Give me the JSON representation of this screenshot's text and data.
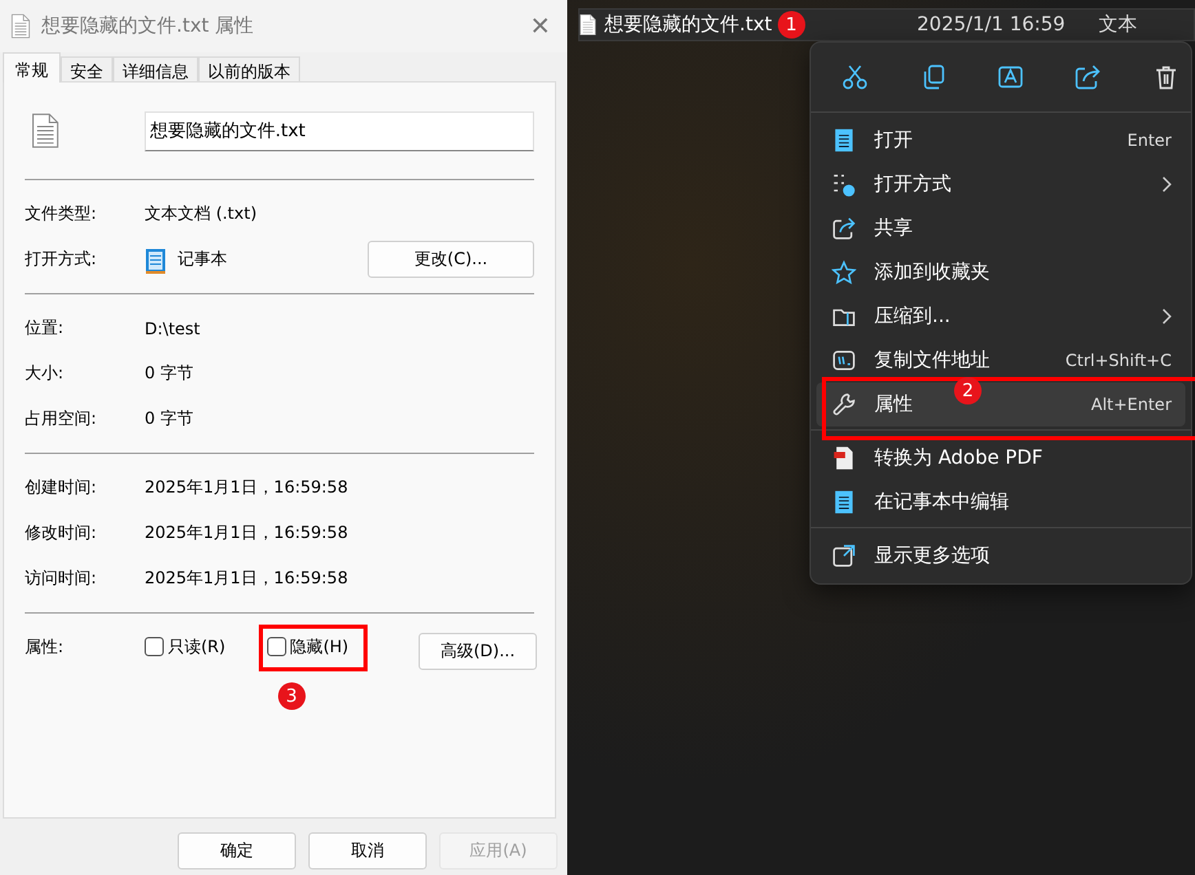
{
  "dialog": {
    "title": "想要隐藏的文件.txt 属性",
    "close_glyph": "✕",
    "tabs": [
      {
        "label": "常规",
        "selected": true
      },
      {
        "label": "安全",
        "selected": false
      },
      {
        "label": "详细信息",
        "selected": false
      },
      {
        "label": "以前的版本",
        "selected": false
      }
    ],
    "file_name": "想要隐藏的文件.txt",
    "groups": [
      [
        {
          "kind": "text",
          "label": "文件类型:",
          "value": "文本文档 (.txt)"
        },
        {
          "kind": "app",
          "label": "打开方式:",
          "value": "记事本",
          "button": "更改(C)..."
        }
      ],
      [
        {
          "kind": "text",
          "label": "位置:",
          "value": "D:\\test"
        },
        {
          "kind": "text",
          "label": "大小:",
          "value": "0 字节"
        },
        {
          "kind": "text",
          "label": "占用空间:",
          "value": "0 字节"
        }
      ],
      [
        {
          "kind": "text",
          "label": "创建时间:",
          "value": "2025年1月1日，16:59:58"
        },
        {
          "kind": "text",
          "label": "修改时间:",
          "value": "2025年1月1日，16:59:58"
        },
        {
          "kind": "text",
          "label": "访问时间:",
          "value": "2025年1月1日，16:59:58"
        }
      ]
    ],
    "attributes": {
      "label": "属性:",
      "checkboxes": [
        {
          "label": "只读(R)",
          "checked": false
        },
        {
          "label": "隐藏(H)",
          "checked": false,
          "callout": "3"
        }
      ],
      "button": "高级(D)..."
    },
    "buttons": [
      {
        "label": "确定",
        "disabled": false
      },
      {
        "label": "取消",
        "disabled": false
      },
      {
        "label": "应用(A)",
        "disabled": true
      }
    ]
  },
  "explorer_row": {
    "name": "想要隐藏的文件.txt",
    "modified": "2025/1/1 16:59",
    "type": "文本",
    "callout": "1"
  },
  "context_menu": {
    "groups": [
      [
        {
          "label": "打开",
          "shortcut": "Enter",
          "submenu": false,
          "selected": false
        },
        {
          "label": "打开方式",
          "submenu": true,
          "selected": false
        },
        {
          "label": "共享",
          "submenu": false,
          "selected": false
        },
        {
          "label": "添加到收藏夹",
          "submenu": false,
          "selected": false
        },
        {
          "label": "压缩到...",
          "submenu": true,
          "selected": false
        },
        {
          "label": "复制文件地址",
          "shortcut": "Ctrl+Shift+C",
          "submenu": false,
          "selected": false
        },
        {
          "label": "属性",
          "shortcut": "Alt+Enter",
          "submenu": false,
          "selected": true,
          "callout": "2"
        }
      ],
      [
        {
          "label": "转换为 Adobe PDF",
          "submenu": false,
          "selected": false
        },
        {
          "label": "在记事本中编辑",
          "submenu": false,
          "selected": false
        }
      ],
      [
        {
          "label": "显示更多选项",
          "submenu": false,
          "selected": false
        }
      ]
    ]
  }
}
